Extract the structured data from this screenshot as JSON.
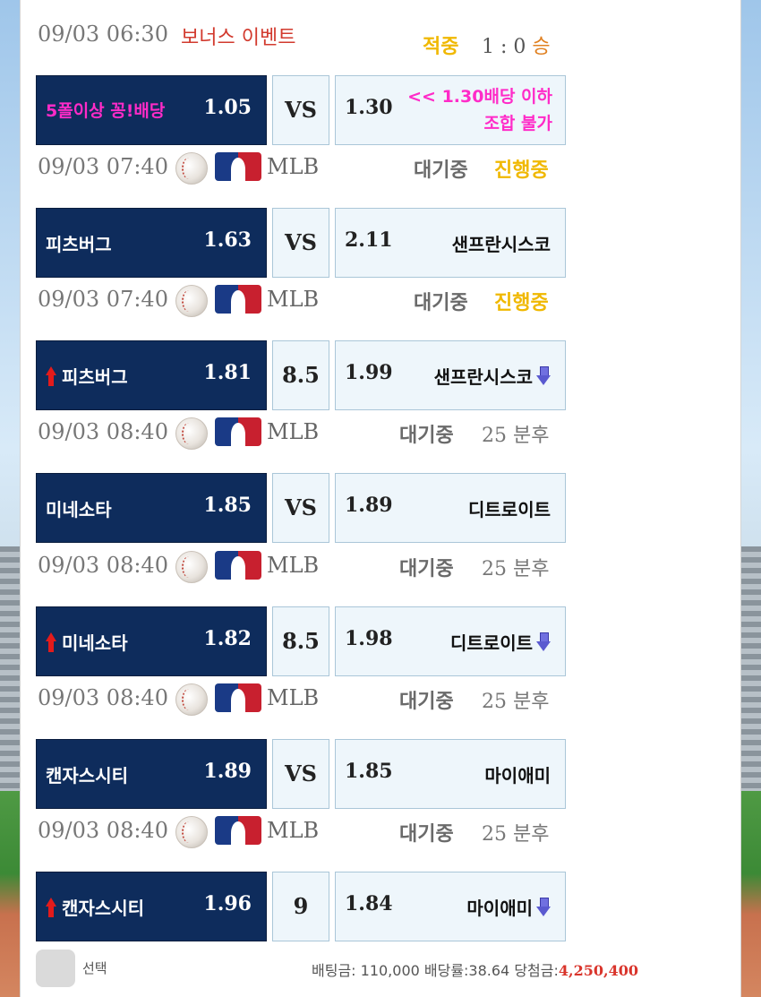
{
  "event_header": {
    "time": "09/03 06:30",
    "title": "보너스 이벤트",
    "result_label": "적중",
    "score": "1 : 0",
    "result": "승"
  },
  "event_row": {
    "home_name": "5폴이상 꽁!배당",
    "home_odds": "1.05",
    "mid": "VS",
    "away_odds": "1.30",
    "note_line1": "<< 1.30배당 이하",
    "note_line2": "조합 불가"
  },
  "games": [
    {
      "time": "09/03 07:40",
      "league": "MLB",
      "status1": "대기중",
      "status2": "진행중",
      "home": "피츠버그",
      "home_odds": "1.63",
      "mid": "VS",
      "away_odds": "2.11",
      "away": "샌프란시스코",
      "handicap": false
    },
    {
      "time": "09/03 07:40",
      "league": "MLB",
      "status1": "대기중",
      "status2": "진행중",
      "home": "피츠버그",
      "home_odds": "1.81",
      "mid": "8.5",
      "away_odds": "1.99",
      "away": "샌프란시스코",
      "handicap": true
    },
    {
      "time": "09/03 08:40",
      "league": "MLB",
      "status1": "대기중",
      "status2": "25 분후",
      "home": "미네소타",
      "home_odds": "1.85",
      "mid": "VS",
      "away_odds": "1.89",
      "away": "디트로이트",
      "handicap": false
    },
    {
      "time": "09/03 08:40",
      "league": "MLB",
      "status1": "대기중",
      "status2": "25 분후",
      "home": "미네소타",
      "home_odds": "1.82",
      "mid": "8.5",
      "away_odds": "1.98",
      "away": "디트로이트",
      "handicap": true
    },
    {
      "time": "09/03 08:40",
      "league": "MLB",
      "status1": "대기중",
      "status2": "25 분후",
      "home": "캔자스시티",
      "home_odds": "1.89",
      "mid": "VS",
      "away_odds": "1.85",
      "away": "마이애미",
      "handicap": false
    },
    {
      "time": "09/03 08:40",
      "league": "MLB",
      "status1": "대기중",
      "status2": "25 분후",
      "home": "캔자스시티",
      "home_odds": "1.96",
      "mid": "9",
      "away_odds": "1.84",
      "away": "마이애미",
      "handicap": true
    }
  ],
  "footer": {
    "select_label": "선택",
    "summary_prefix": "배팅금: 110,000 배당률:38.64 당첨금:",
    "win_amount": "4,250,400"
  },
  "colors": {
    "home_bg": "#0e2c5c",
    "away_bg": "#eef6fb",
    "status_live": "#f0b800",
    "event_title": "#d23a2e",
    "pink_note": "#ff2bc8",
    "win_amount": "#d9342b"
  }
}
